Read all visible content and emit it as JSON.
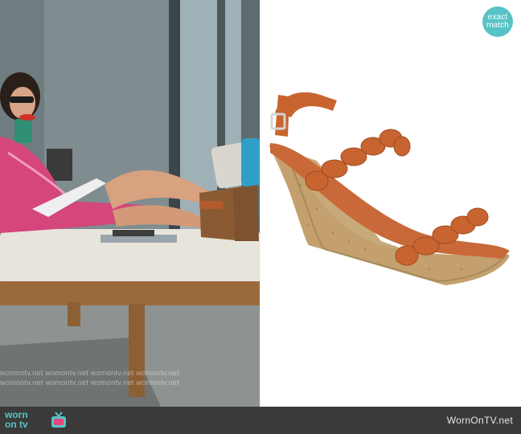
{
  "badge": {
    "line1": "exact",
    "line2": "match"
  },
  "watermark": {
    "lines": [
      "womontv.net  womontv.net  womontv.net  womontv.net",
      "womontv.net  womontv.net  womontv.net  womontv.net"
    ]
  },
  "footer": {
    "logo_line1": "worn",
    "logo_line2": "on tv",
    "site": "WornOnTV.net"
  },
  "colors": {
    "brand_teal": "#58c3c6",
    "footer_bg": "#3a3a3a",
    "sandal_leather": "#c8642f",
    "cork": "#c8a97a"
  },
  "icons": [
    "tv-icon"
  ]
}
